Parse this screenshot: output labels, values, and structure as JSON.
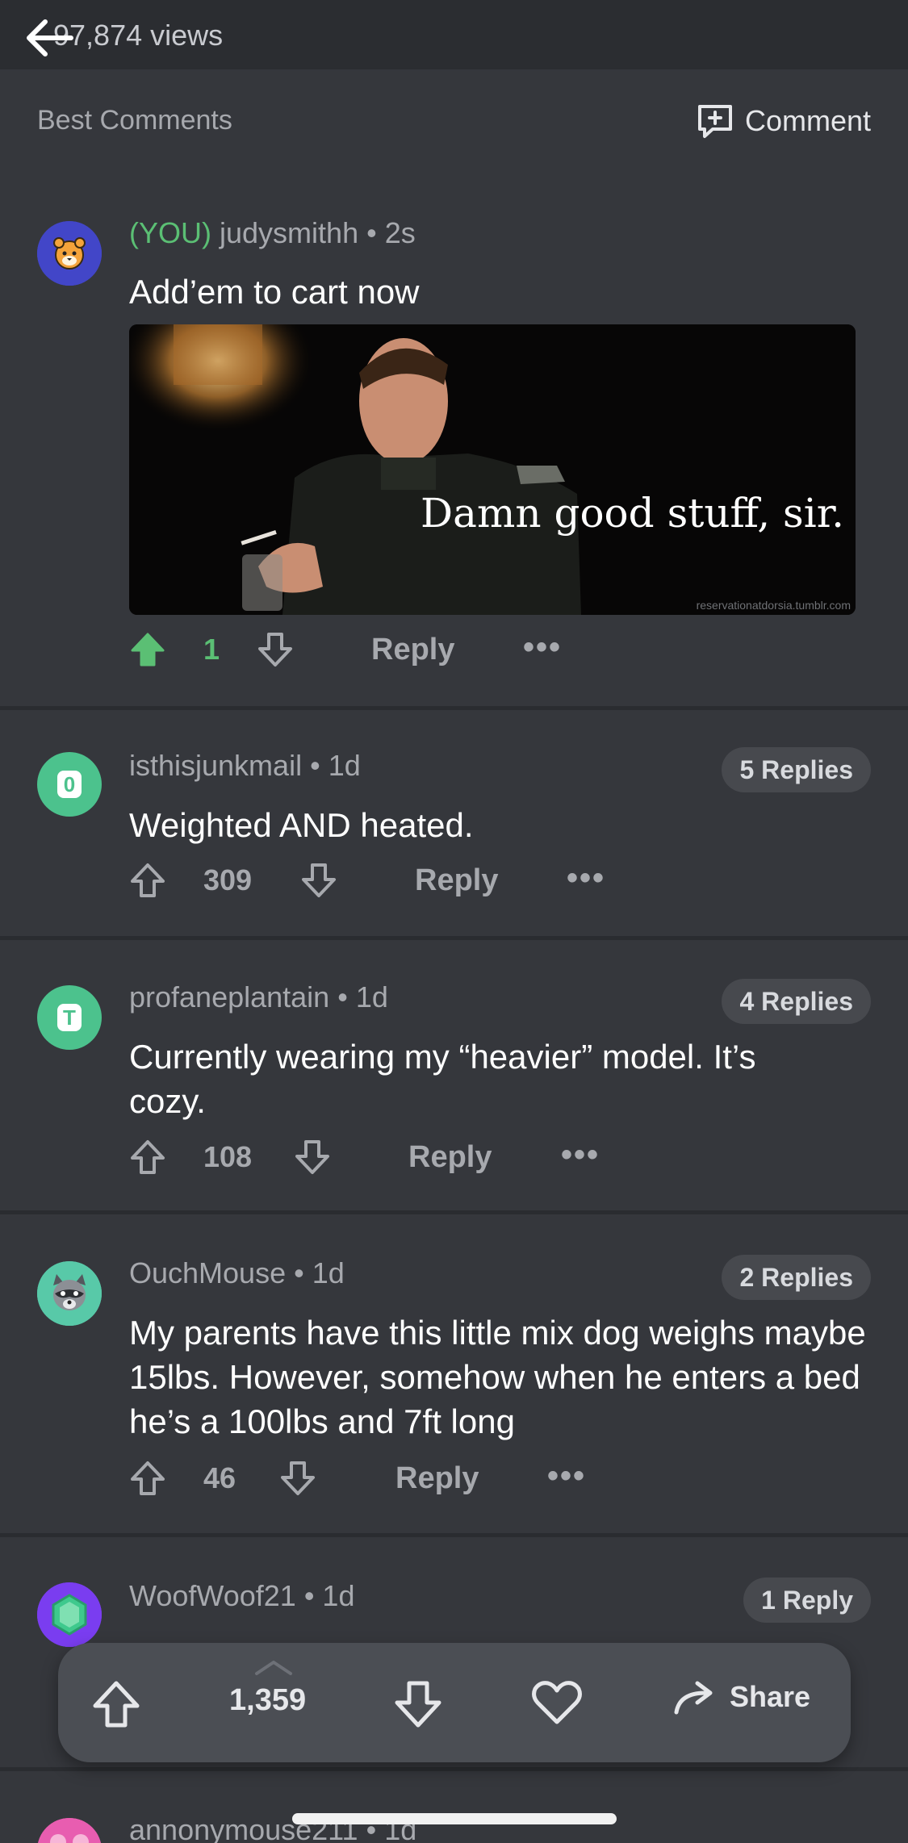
{
  "header": {
    "views_text": "97,874 views"
  },
  "section": {
    "title": "Best Comments",
    "comment_button": "Comment"
  },
  "comments": [
    {
      "you_tag": "(YOU)",
      "username": "judysmithh",
      "time": "2s",
      "text": "Add’em to cart now",
      "avatar_color": "#4246c8",
      "image": {
        "caption": "Damn good stuff, sir.",
        "credit": "reservationatdorsia.tumblr.com"
      },
      "votes": "1",
      "reply_label": "Reply",
      "more_label": "•••"
    },
    {
      "username": "isthisjunkmail",
      "time": "1d",
      "text": "Weighted AND heated.",
      "avatar_letter": "0",
      "avatar_color": "#4cc28d",
      "replies": "5 Replies",
      "votes": "309",
      "reply_label": "Reply",
      "more_label": "•••"
    },
    {
      "username": "profaneplantain",
      "time": "1d",
      "text": "Currently wearing my “heavier” model. It’s cozy.",
      "avatar_letter": "T",
      "avatar_color": "#4cc28d",
      "replies": "4 Replies",
      "votes": "108",
      "reply_label": "Reply",
      "more_label": "•••"
    },
    {
      "username": "OuchMouse",
      "time": "1d",
      "text": "My parents have this little mix dog weighs maybe 15lbs. However, somehow when he enters a bed he’s a 100lbs and 7ft long",
      "avatar_color": "#58c9a8",
      "replies": "2 Replies",
      "votes": "46",
      "reply_label": "Reply",
      "more_label": "•••"
    },
    {
      "username": "WoofWoof21",
      "time": "1d",
      "avatar_color": "#7a3df0",
      "replies": "1 Reply"
    },
    {
      "username": "annonymouse211",
      "time": "1d",
      "avatar_color": "#e85db0"
    }
  ],
  "bottom_bar": {
    "points": "1,359",
    "share_label": "Share"
  },
  "colors": {
    "upvote_active": "#5bbf74",
    "background": "#35373c"
  }
}
